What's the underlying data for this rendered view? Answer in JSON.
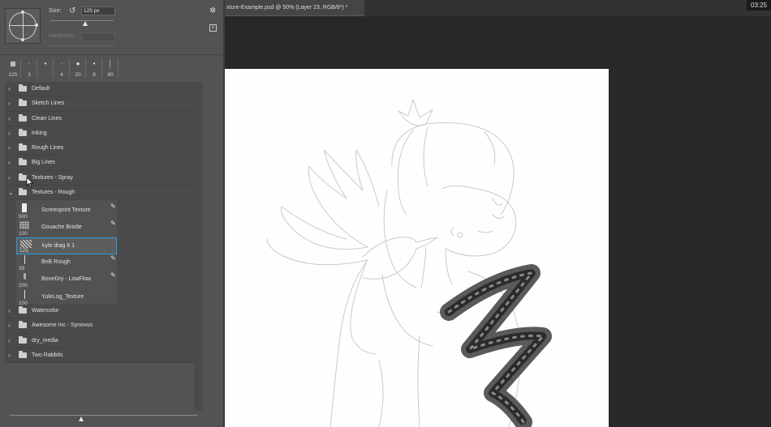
{
  "brush_settings": {
    "size_label": "Size:",
    "size_value": "125 px",
    "size_slider_fraction": 0.55,
    "hardness_label": "Hardness:"
  },
  "recent_brushes": [
    {
      "size": "125",
      "glyph": "▦"
    },
    {
      "size": "3",
      "glyph": "·"
    },
    {
      "size": "",
      "glyph": "•"
    },
    {
      "size": "4",
      "glyph": "·"
    },
    {
      "size": "20",
      "glyph": "●"
    },
    {
      "size": "8",
      "glyph": "•"
    },
    {
      "size": "80",
      "glyph": "│"
    }
  ],
  "folders_top": [
    {
      "label": "Default"
    },
    {
      "label": "Sketch Lines"
    },
    {
      "label": "Clean Lines"
    },
    {
      "label": "Inking"
    },
    {
      "label": "Rough Lines"
    },
    {
      "label": "Big Lines"
    },
    {
      "label": "Textures - Spray"
    },
    {
      "label": "Textures - Rough"
    }
  ],
  "expanded_folder": "Textures - Rough",
  "presets": [
    {
      "size": "500",
      "name": "Screenprint Texture"
    },
    {
      "size": "100",
      "name": "Gouache Bristle"
    },
    {
      "size": "125",
      "name": "kyle drag 6 1"
    },
    {
      "size": "39",
      "name": "BnB Rough"
    },
    {
      "size": "200",
      "name": "BoneDry - LowFlow"
    },
    {
      "size": "100",
      "name": "YuleLog_Texture"
    }
  ],
  "selected_preset": "kyle drag 6 1",
  "folders_bottom": [
    {
      "label": "Watercolor"
    },
    {
      "label": "Awesome Inc - Synovus"
    },
    {
      "label": "dry_media"
    },
    {
      "label": "Two Rabbits"
    }
  ],
  "document": {
    "tab_title": "xture-Example.psd @ 50% (Layer 23, RGB/8*) *"
  },
  "clock": "03:25",
  "colors": {
    "selection": "#2c9be6",
    "panel": "#535353",
    "workspace": "#282828"
  }
}
